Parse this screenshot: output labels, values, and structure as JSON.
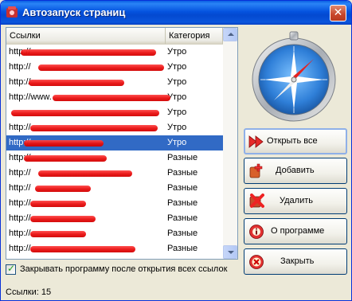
{
  "window": {
    "title": "Автозапуск страниц",
    "close_glyph": "✕"
  },
  "list": {
    "columns": {
      "links": "Ссылки",
      "category": "Категория"
    },
    "rows": [
      {
        "url": "http://",
        "category": "Утро",
        "selected": false
      },
      {
        "url": "http://",
        "category": "Утро",
        "selected": false
      },
      {
        "url": "http://",
        "category": "Утро",
        "selected": false
      },
      {
        "url": "http://www.",
        "category": "Утро",
        "selected": false
      },
      {
        "url": "",
        "category": "Утро",
        "selected": false
      },
      {
        "url": "http://",
        "category": "Утро",
        "selected": false
      },
      {
        "url": "http://",
        "category": "Утро",
        "selected": true
      },
      {
        "url": "http://",
        "category": "Разные",
        "selected": false
      },
      {
        "url": "http://",
        "category": "Разные",
        "selected": false
      },
      {
        "url": "http://",
        "category": "Разные",
        "selected": false
      },
      {
        "url": "http://",
        "category": "Разные",
        "selected": false
      },
      {
        "url": "http://",
        "category": "Разные",
        "selected": false
      },
      {
        "url": "http://",
        "category": "Разные",
        "selected": false
      },
      {
        "url": "http://",
        "category": "Разные",
        "selected": false
      },
      {
        "url": "http://",
        "category": "Разные",
        "selected": false
      }
    ]
  },
  "options": {
    "close_after_open_label": "Закрывать программу после открытия всех ссылок",
    "close_after_open_checked": true
  },
  "status": {
    "text": "Ссылки: 15"
  },
  "buttons": {
    "open_all": "Открыть все",
    "add": "Добавить",
    "delete": "Удалить",
    "about": "О программе",
    "close": "Закрыть"
  },
  "colors": {
    "selection": "#316ac5",
    "redaction": "#e80d0d",
    "titlebar": "#0553df"
  },
  "icons": {
    "app": "app-icon",
    "compass": "compass-icon",
    "open_all": "fast-forward-icon",
    "add": "add-icon",
    "delete": "delete-icon",
    "about": "info-icon",
    "close": "close-icon"
  }
}
